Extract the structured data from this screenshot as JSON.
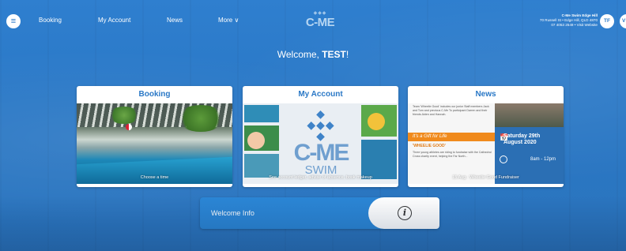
{
  "nav": {
    "menu_icon": "hamburger-icon",
    "links": [
      "Booking",
      "My Account",
      "News",
      "More ∨"
    ],
    "logo_text": "C-ME"
  },
  "school": {
    "name": "C-Me Swim Edge Hill",
    "address": "70 Russell St • Edge Hill, QLD 4870",
    "contact": "07 4053 2549 • Visit Website"
  },
  "user": {
    "initials": "TF",
    "second_initial": "V"
  },
  "welcome": {
    "prefix": "Welcome, ",
    "name": "TEST",
    "suffix": "!"
  },
  "cards": [
    {
      "title": "Booking",
      "caption": "Choose a time"
    },
    {
      "title": "My Account",
      "caption": "See account ledger, advise of absence, book makeup",
      "logo_big": "C-ME",
      "logo_small": "SWIM"
    },
    {
      "title": "News",
      "caption": "15 Aug · Wheelie Good Fundraiser",
      "flyer_intro": "Team 'Wheelie Good' includes our junior Staff members Jack and Tom and previous C-Me To participant Darren and their friends Aiden and Hannah.",
      "flyer_banner": "It's a Gift for Life",
      "flyer_heading": "'WHEELIE GOOD'",
      "flyer_body": "Three young athletes are riding to fundraise with the Cathedral Cross charity event, helping the Far North...",
      "flyer_date": "Saturday 29th August 2020",
      "flyer_time": "8am - 12pm"
    }
  ],
  "welcome_info": {
    "label": "Welcome Info",
    "icon": "info-icon",
    "icon_glyph": "i"
  },
  "colors": {
    "background": "#2a78c6",
    "accent": "#2a78c6",
    "banner_orange": "#f08a1c"
  }
}
